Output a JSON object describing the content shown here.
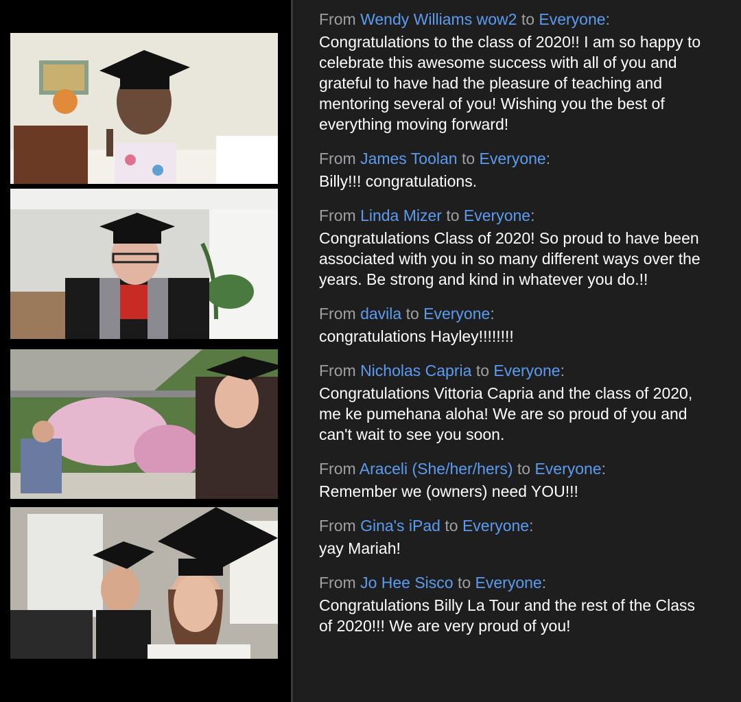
{
  "video_panel": {
    "tiles": [
      {
        "label": "video-tile-1"
      },
      {
        "label": "video-tile-2"
      },
      {
        "label": "video-tile-3"
      },
      {
        "label": "video-tile-4"
      }
    ]
  },
  "chat": {
    "from_word": "From",
    "to_word": "to",
    "messages": [
      {
        "sender": "Wendy Williams  wow2",
        "recipient": "Everyone",
        "lines": [
          "Congratulations to the class of 2020!! I am so happy to",
          "celebrate this awesome success with all of you and",
          "grateful to have had the pleasure of teaching and",
          "mentoring several of you! Wishing you the best of",
          "everything moving forward!"
        ]
      },
      {
        "sender": "James Toolan",
        "recipient": "Everyone",
        "lines": [
          "Billy!!! congratulations."
        ]
      },
      {
        "sender": "Linda Mizer",
        "recipient": "Everyone",
        "lines": [
          "Congratulations Class of 2020! So proud to have been",
          "associated with you in so many different ways over the",
          "years. Be strong and kind in whatever you do.!!"
        ]
      },
      {
        "sender": "davila",
        "recipient": "Everyone",
        "lines": [
          "congratulations Hayley!!!!!!!!"
        ]
      },
      {
        "sender": "Nicholas Capria",
        "recipient": "Everyone",
        "lines": [
          "Congratulations Vittoria Capria and the class of 2020,",
          "me ke pumehana aloha!  We are so proud of you and",
          "can't wait to see you soon."
        ]
      },
      {
        "sender": "Araceli (She/her/hers)",
        "recipient": "Everyone",
        "lines": [
          "Remember we (owners) need YOU!!!"
        ]
      },
      {
        "sender": "Gina's iPad",
        "recipient": "Everyone",
        "lines": [
          "yay Mariah!"
        ]
      },
      {
        "sender": "Jo Hee Sisco",
        "recipient": "Everyone",
        "lines": [
          "Congratulations Billy La Tour and the rest of the Class",
          "of 2020!!! We are very proud of you!"
        ]
      }
    ]
  },
  "colors": {
    "chat_background": "#1e1e1e",
    "sender_link": "#5b9cf0",
    "meta_text": "#a0a0a4",
    "message_text": "#ffffff"
  }
}
